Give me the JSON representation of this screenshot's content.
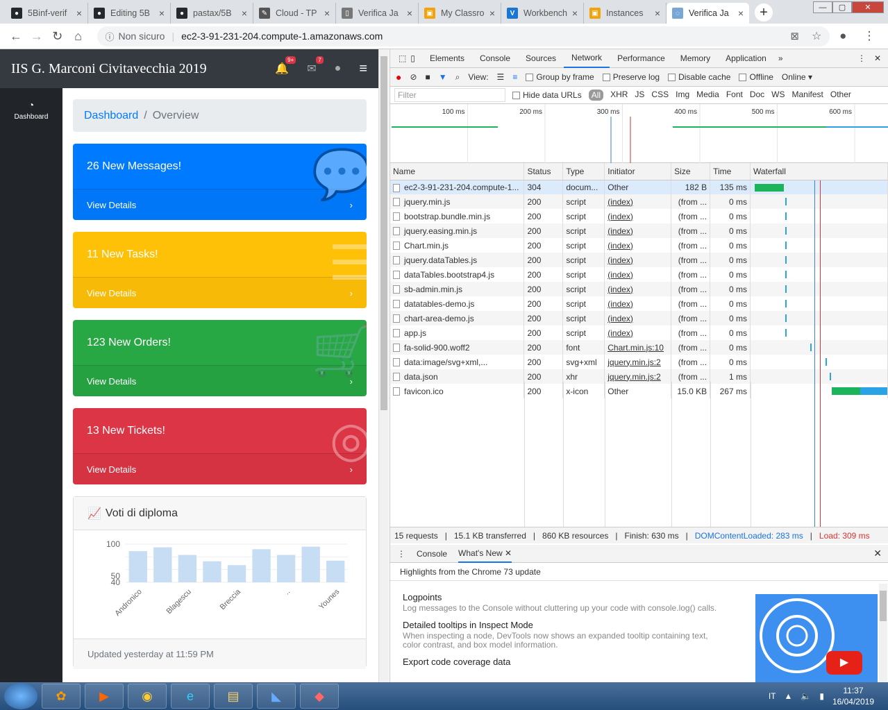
{
  "browser": {
    "tabs": [
      {
        "title": "5Binf-verif",
        "icon": "github-icon",
        "active": false
      },
      {
        "title": "Editing 5B",
        "icon": "github-icon",
        "active": false
      },
      {
        "title": "pastax/5B",
        "icon": "github-icon",
        "active": false
      },
      {
        "title": "Cloud - TP",
        "icon": "notebook-icon",
        "active": false
      },
      {
        "title": "Verifica Ja",
        "icon": "document-icon",
        "active": false
      },
      {
        "title": "My Classro",
        "icon": "aws-box-icon",
        "active": false
      },
      {
        "title": "Workbench",
        "icon": "vocareum-icon",
        "active": false
      },
      {
        "title": "Instances",
        "icon": "aws-box-icon",
        "active": false
      },
      {
        "title": "Verifica Ja",
        "icon": "loading-icon",
        "active": true
      }
    ],
    "not_secure": "Non sicuro",
    "url": "ec2-3-91-231-204.compute-1.amazonaws.com"
  },
  "app": {
    "brand": "IIS G. Marconi Civitavecchia 2019",
    "alerts_badge": "9+",
    "messages_badge": "7",
    "sidebar": [
      {
        "label": "Dashboard",
        "icon": "tachometer-icon"
      }
    ],
    "breadcrumb": {
      "link": "Dashboard",
      "current": "Overview"
    },
    "cards": [
      {
        "text": "26 New Messages!",
        "link": "View Details",
        "color": "#007bff",
        "icon": "comments-icon"
      },
      {
        "text": "11 New Tasks!",
        "link": "View Details",
        "color": "#ffc107",
        "icon": "list-icon"
      },
      {
        "text": "123 New Orders!",
        "link": "View Details",
        "color": "#28a745",
        "icon": "shopping-cart-icon"
      },
      {
        "text": "13 New Tickets!",
        "link": "View Details",
        "color": "#dc3545",
        "icon": "life-ring-icon"
      }
    ],
    "chart_card": {
      "title": "Voti di diploma",
      "footer": "Updated yesterday at 11:59 PM"
    }
  },
  "chart_data": {
    "type": "bar",
    "categories": [
      "Andronico",
      "",
      "Blagescu",
      "",
      "Breccia",
      "",
      "..",
      "",
      "Younes"
    ],
    "values": [
      89,
      95,
      83,
      73,
      67,
      92,
      83,
      96,
      74
    ],
    "yticks": [
      "100",
      "50",
      "40"
    ],
    "ylim": [
      40,
      100
    ],
    "color": "#c6ddf3"
  },
  "devtools": {
    "tabs": [
      "Elements",
      "Console",
      "Sources",
      "Network",
      "Performance",
      "Memory",
      "Application"
    ],
    "active_tab": "Network",
    "toolbar": {
      "view": "View:",
      "group_by_frame": "Group by frame",
      "preserve_log": "Preserve log",
      "disable_cache": "Disable cache",
      "offline": "Offline",
      "online": "Online"
    },
    "filter": {
      "placeholder": "Filter",
      "hide_data_urls": "Hide data URLs",
      "types": [
        "All",
        "XHR",
        "JS",
        "CSS",
        "Img",
        "Media",
        "Font",
        "Doc",
        "WS",
        "Manifest",
        "Other"
      ]
    },
    "timeline_ticks": [
      "100 ms",
      "200 ms",
      "300 ms",
      "400 ms",
      "500 ms",
      "600 ms"
    ],
    "columns": [
      "Name",
      "Status",
      "Type",
      "Initiator",
      "Size",
      "Time",
      "Waterfall"
    ],
    "rows": [
      {
        "name": "ec2-3-91-231-204.compute-1...",
        "status": "304",
        "type": "docum...",
        "initiator": "Other",
        "size": "182 B",
        "time": "135 ms"
      },
      {
        "name": "jquery.min.js",
        "status": "200",
        "type": "script",
        "initiator": "(index)",
        "size": "(from ...",
        "time": "0 ms"
      },
      {
        "name": "bootstrap.bundle.min.js",
        "status": "200",
        "type": "script",
        "initiator": "(index)",
        "size": "(from ...",
        "time": "0 ms"
      },
      {
        "name": "jquery.easing.min.js",
        "status": "200",
        "type": "script",
        "initiator": "(index)",
        "size": "(from ...",
        "time": "0 ms"
      },
      {
        "name": "Chart.min.js",
        "status": "200",
        "type": "script",
        "initiator": "(index)",
        "size": "(from ...",
        "time": "0 ms"
      },
      {
        "name": "jquery.dataTables.js",
        "status": "200",
        "type": "script",
        "initiator": "(index)",
        "size": "(from ...",
        "time": "0 ms"
      },
      {
        "name": "dataTables.bootstrap4.js",
        "status": "200",
        "type": "script",
        "initiator": "(index)",
        "size": "(from ...",
        "time": "0 ms"
      },
      {
        "name": "sb-admin.min.js",
        "status": "200",
        "type": "script",
        "initiator": "(index)",
        "size": "(from ...",
        "time": "0 ms"
      },
      {
        "name": "datatables-demo.js",
        "status": "200",
        "type": "script",
        "initiator": "(index)",
        "size": "(from ...",
        "time": "0 ms"
      },
      {
        "name": "chart-area-demo.js",
        "status": "200",
        "type": "script",
        "initiator": "(index)",
        "size": "(from ...",
        "time": "0 ms"
      },
      {
        "name": "app.js",
        "status": "200",
        "type": "script",
        "initiator": "(index)",
        "size": "(from ...",
        "time": "0 ms"
      },
      {
        "name": "fa-solid-900.woff2",
        "status": "200",
        "type": "font",
        "initiator": "Chart.min.js:10",
        "size": "(from ...",
        "time": "0 ms"
      },
      {
        "name": "data:image/svg+xml,...",
        "status": "200",
        "type": "svg+xml",
        "initiator": "jquery.min.js:2",
        "size": "(from ...",
        "time": "0 ms"
      },
      {
        "name": "data.json",
        "status": "200",
        "type": "xhr",
        "initiator": "jquery.min.js:2",
        "size": "(from ...",
        "time": "1 ms"
      },
      {
        "name": "favicon.ico",
        "status": "200",
        "type": "x-icon",
        "initiator": "Other",
        "size": "15.0 KB",
        "time": "267 ms"
      }
    ],
    "summary": {
      "requests": "15 requests",
      "transferred": "15.1 KB transferred",
      "resources": "860 KB resources",
      "finish": "Finish: 630 ms",
      "dcl": "DOMContentLoaded: 283 ms",
      "load": "Load: 309 ms"
    },
    "drawer": {
      "tabs": [
        "Console",
        "What's New"
      ],
      "heading": "Highlights from the Chrome 73 update",
      "items": [
        {
          "title": "Logpoints",
          "desc": "Log messages to the Console without cluttering up your code with console.log() calls."
        },
        {
          "title": "Detailed tooltips in Inspect Mode",
          "desc": "When inspecting a node, DevTools now shows an expanded tooltip containing text, color contrast, and box model information."
        },
        {
          "title": "Export code coverage data",
          "desc": ""
        }
      ]
    }
  },
  "taskbar": {
    "lang": "IT",
    "time": "11:37",
    "date": "16/04/2019"
  }
}
